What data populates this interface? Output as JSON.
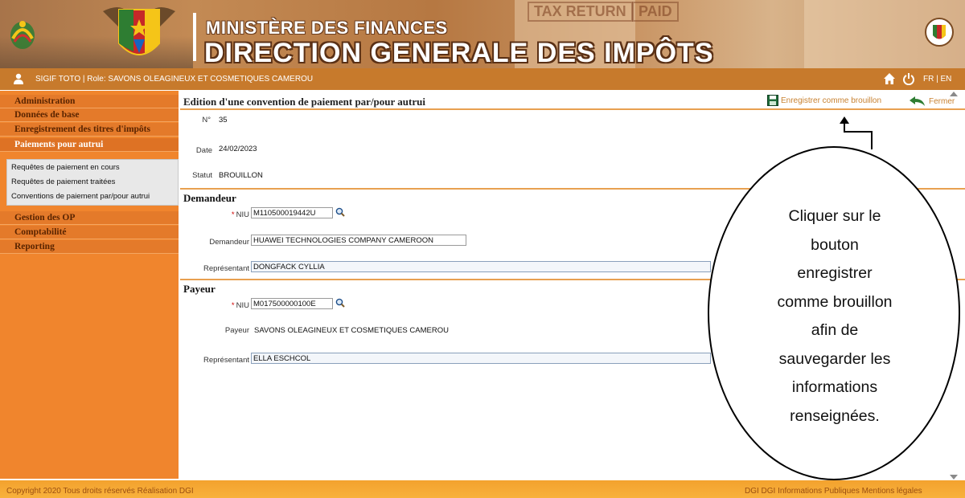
{
  "banner": {
    "ministry": "MINISTÈRE DES FINANCES",
    "direction": "DIRECTION GENERALE DES IMPÔTS",
    "stamps": [
      "TAX RETURN",
      "PAID"
    ]
  },
  "userbar": {
    "user_text": "SIGIF TOTO | Role: SAVONS OLEAGINEUX ET COSMETIQUES CAMEROU",
    "lang_fr": "FR",
    "lang_sep": "|",
    "lang_en": "EN"
  },
  "sidebar": {
    "items": [
      {
        "label": "Administration"
      },
      {
        "label": "Données de base"
      },
      {
        "label": "Enregistrement des titres d'impôts"
      },
      {
        "label": "Paiements pour autrui"
      }
    ],
    "submenu": [
      {
        "label": "Requêtes de paiement en cours"
      },
      {
        "label": "Requêtes de paiement traitées"
      },
      {
        "label": "Conventions de paiement par/pour autrui"
      }
    ],
    "items_after": [
      {
        "label": "Gestion des OP"
      },
      {
        "label": "Comptabilité"
      },
      {
        "label": "Reporting"
      }
    ]
  },
  "main": {
    "title": "Edition d'une convention de paiement par/pour autrui",
    "save_label": "Enregistrer comme brouillon",
    "close_label": "Fermer",
    "no_label": "N°",
    "no_value": "35",
    "date_label": "Date",
    "date_value": "24/02/2023",
    "status_label": "Statut",
    "status_value": "BROUILLON",
    "demandeur": {
      "section": "Demandeur",
      "niu_label": "NIU",
      "niu_value": "M110500019442U",
      "name_label": "Demandeur",
      "name_value": "HUAWEI TECHNOLOGIES COMPANY CAMEROON",
      "rep_label": "Représentant",
      "rep_value": "DONGFACK CYLLIA"
    },
    "payeur": {
      "section": "Payeur",
      "niu_label": "NIU",
      "niu_value": "M017500000100E",
      "name_label": "Payeur",
      "name_value": "SAVONS OLEAGINEUX ET COSMETIQUES CAMEROU",
      "rep_label": "Représentant",
      "rep_value": "ELLA ESCHCOL"
    }
  },
  "callout": {
    "lines": [
      "Cliquer sur le",
      "bouton",
      "enregistrer",
      "comme brouillon",
      "afin de",
      "sauvegarder les",
      "informations",
      "renseignées."
    ]
  },
  "footer": {
    "left": "Copyright 2020 Tous droits réservés  Réalisation DGI",
    "right": "DGI   DGI Informations Publiques   Mentions légales"
  },
  "colors": {
    "accent": "#c77a2c",
    "sidebar": "#f0852d",
    "footer": "#f8b13c"
  }
}
